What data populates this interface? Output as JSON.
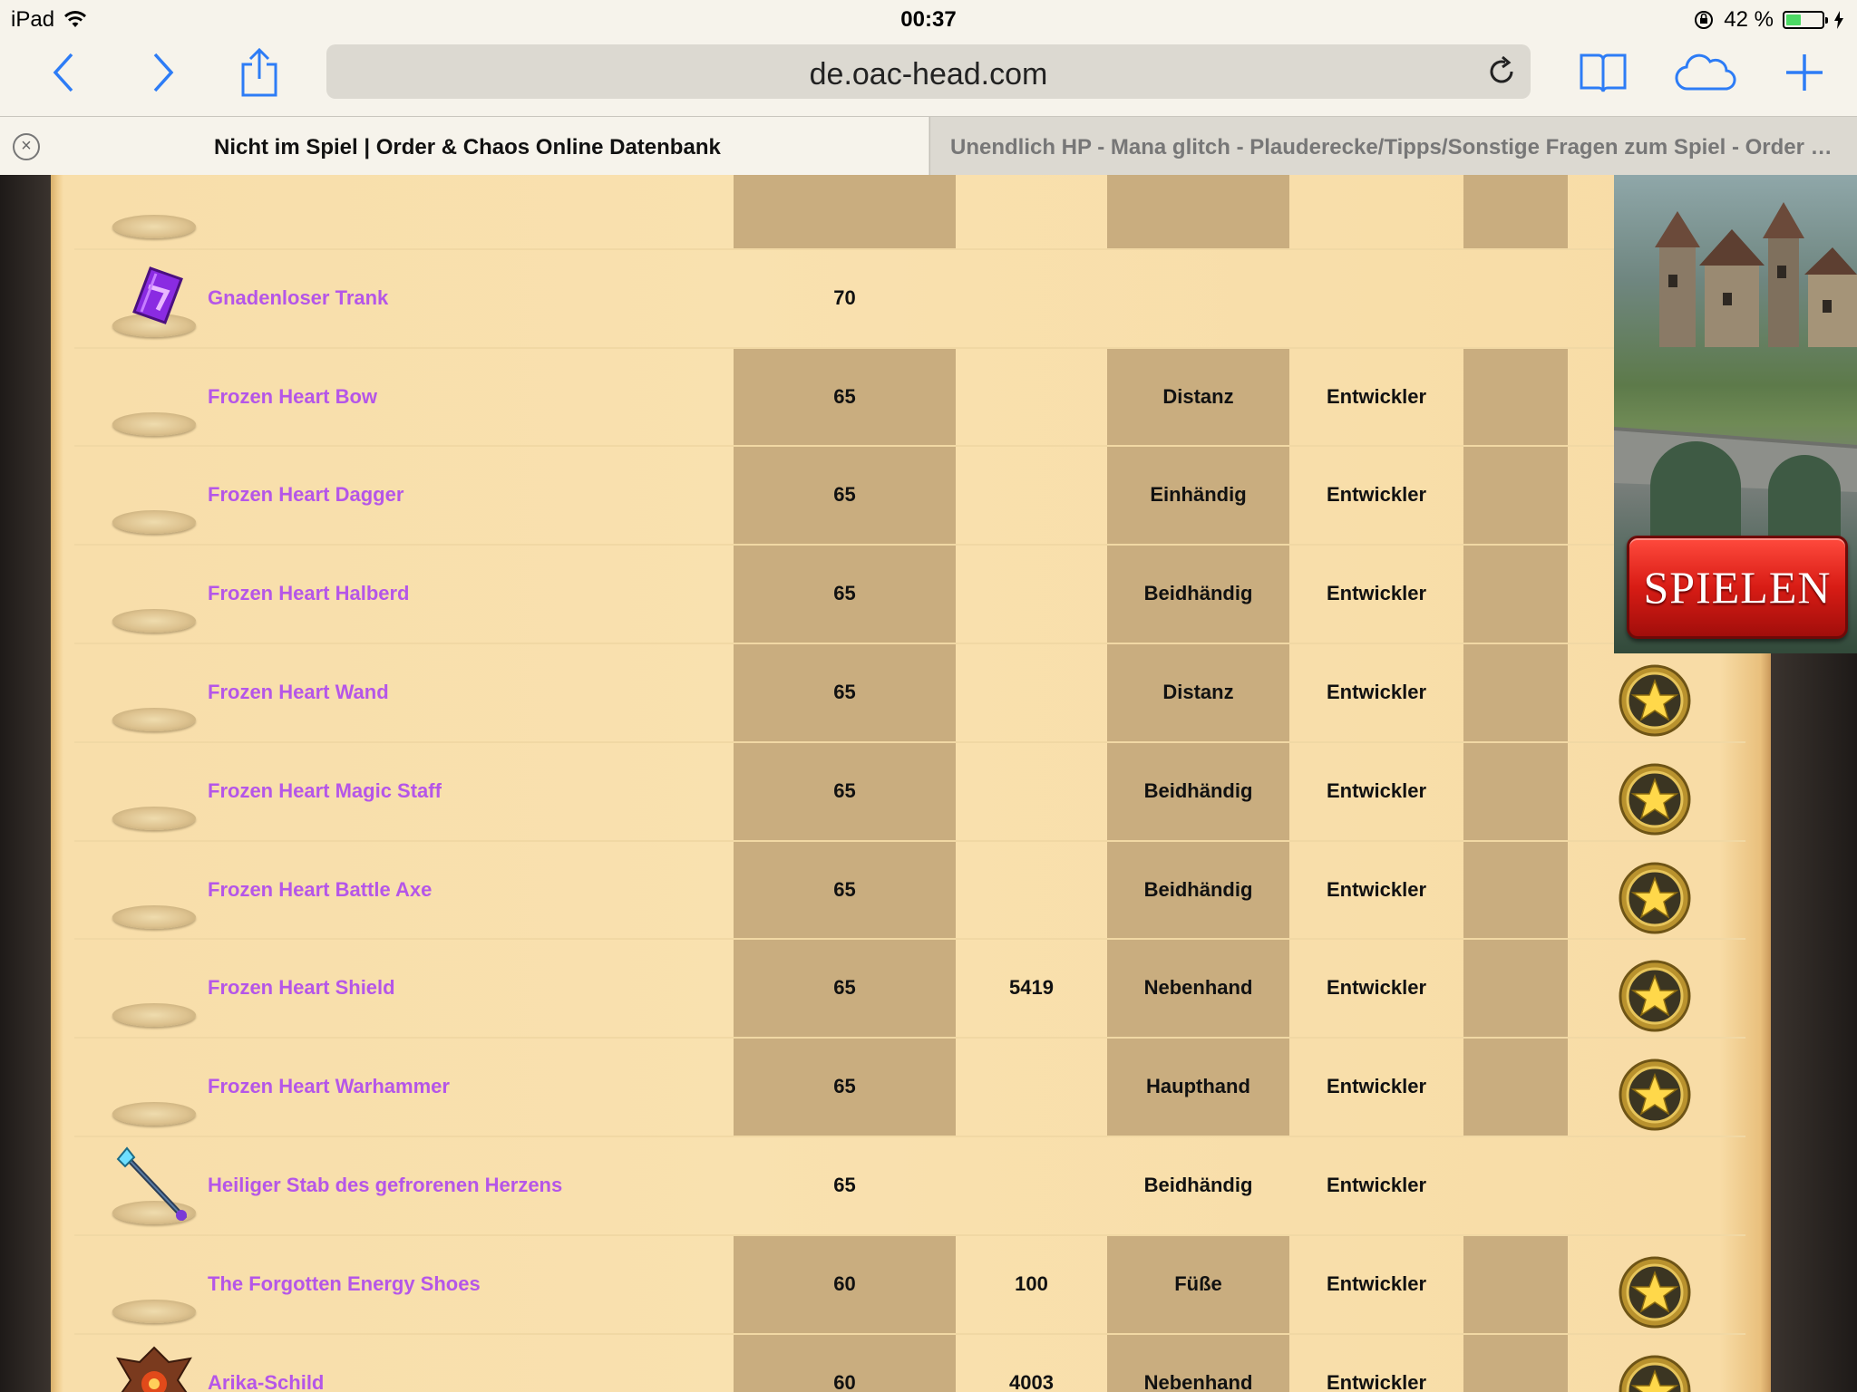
{
  "status": {
    "device": "iPad",
    "time": "00:37",
    "battery": "42 %",
    "battery_level": 0.42
  },
  "browser": {
    "url": "de.oac-head.com",
    "tabs": [
      {
        "title": "Nicht im Spiel | Order & Chaos Online Datenbank",
        "active": true
      },
      {
        "title": "Unendlich HP - Mana glitch - Plauderecke/Tipps/Sonstige Fragen zum Spiel - Order & Chaos Online",
        "active": false
      }
    ],
    "accent_color": "#2d7cf6"
  },
  "items": [
    {
      "name": "",
      "level": "",
      "value": "",
      "type": "",
      "source": "",
      "icon": "pedestal",
      "badge": false,
      "banded": true
    },
    {
      "name": "Gnadenloser Trank",
      "level": "70",
      "value": "",
      "type": "",
      "source": "",
      "icon": "purple-potion-icon",
      "badge": false,
      "banded": false
    },
    {
      "name": "Frozen Heart Bow",
      "level": "65",
      "value": "",
      "type": "Distanz",
      "source": "Entwickler",
      "icon": "pedestal",
      "badge": false,
      "banded": true
    },
    {
      "name": "Frozen Heart Dagger",
      "level": "65",
      "value": "",
      "type": "Einhändig",
      "source": "Entwickler",
      "icon": "pedestal",
      "badge": false,
      "banded": true
    },
    {
      "name": "Frozen Heart Halberd",
      "level": "65",
      "value": "",
      "type": "Beidhändig",
      "source": "Entwickler",
      "icon": "pedestal",
      "badge": false,
      "banded": true
    },
    {
      "name": "Frozen Heart Wand",
      "level": "65",
      "value": "",
      "type": "Distanz",
      "source": "Entwickler",
      "icon": "pedestal",
      "badge": true,
      "banded": true
    },
    {
      "name": "Frozen Heart Magic Staff",
      "level": "65",
      "value": "",
      "type": "Beidhändig",
      "source": "Entwickler",
      "icon": "pedestal",
      "badge": true,
      "banded": true
    },
    {
      "name": "Frozen Heart Battle Axe",
      "level": "65",
      "value": "",
      "type": "Beidhändig",
      "source": "Entwickler",
      "icon": "pedestal",
      "badge": true,
      "banded": true
    },
    {
      "name": "Frozen Heart Shield",
      "level": "65",
      "value": "5419",
      "type": "Nebenhand",
      "source": "Entwickler",
      "icon": "pedestal",
      "badge": true,
      "banded": true
    },
    {
      "name": "Frozen Heart Warhammer",
      "level": "65",
      "value": "",
      "type": "Haupthand",
      "source": "Entwickler",
      "icon": "pedestal",
      "badge": true,
      "banded": true
    },
    {
      "name": "Heiliger Stab des gefrorenen Herzens",
      "level": "65",
      "value": "",
      "type": "Beidhändig",
      "source": "Entwickler",
      "icon": "staff-icon",
      "badge": false,
      "banded": false
    },
    {
      "name": "The Forgotten Energy Shoes",
      "level": "60",
      "value": "100",
      "type": "Füße",
      "source": "Entwickler",
      "icon": "pedestal",
      "badge": true,
      "banded": true
    },
    {
      "name": "Arika-Schild",
      "level": "60",
      "value": "4003",
      "type": "Nebenhand",
      "source": "Entwickler",
      "icon": "dragon-shield-icon",
      "badge": true,
      "banded": true
    }
  ],
  "ad": {
    "button_label": "SPIELEN"
  },
  "colors": {
    "item_link": "#b556e8",
    "band": "#c9ad7f",
    "parchment": "#f9e1af"
  }
}
